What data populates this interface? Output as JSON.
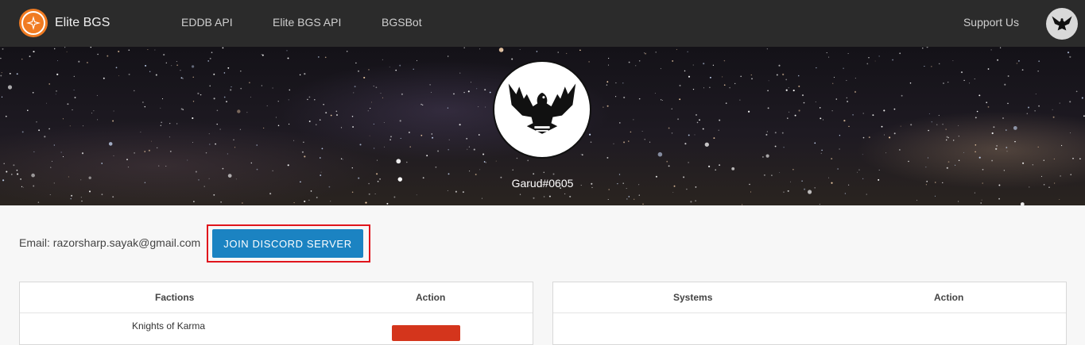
{
  "navbar": {
    "brand": "Elite BGS",
    "links": [
      "EDDB API",
      "Elite BGS API",
      "BGSBot"
    ],
    "support": "Support Us"
  },
  "hero": {
    "username": "Garud#0605"
  },
  "profile": {
    "email": "Email: razorsharp.sayak@gmail.com",
    "discord_button": "Join Discord Server"
  },
  "factions_table": {
    "headers": [
      "Factions",
      "Action"
    ],
    "rows": [
      {
        "name": "Knights of Karma"
      }
    ]
  },
  "systems_table": {
    "headers": [
      "Systems",
      "Action"
    ]
  },
  "colors": {
    "navbar": "#2b2b2b",
    "accent": "#1b83c2",
    "brand_orange": "#f07b22",
    "highlight": "#e0141c",
    "danger": "#d4351c"
  },
  "icons": {
    "brand": "star-logo-icon",
    "avatar": "phoenix-emblem-icon"
  }
}
